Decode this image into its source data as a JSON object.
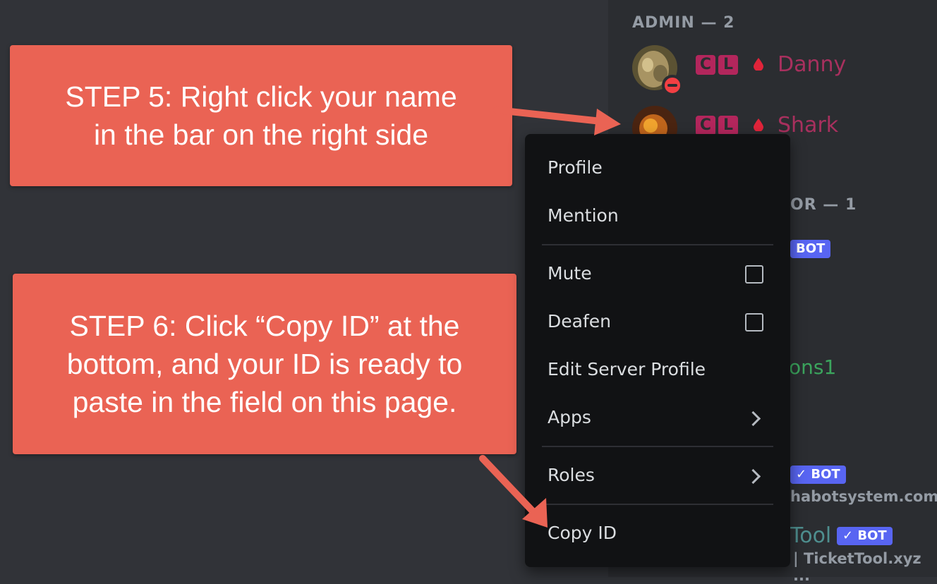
{
  "member_list": {
    "admin_header": "ADMIN — 2",
    "mod_header_partial": "OR — 1",
    "tag_c": "C",
    "tag_l": "L",
    "members": [
      {
        "name": "Danny"
      },
      {
        "name": "Shark"
      }
    ],
    "bot_badge": "BOT",
    "verified_bot_badge": "✓ BOT",
    "partial_name_green": "ons1",
    "partial_status_1": "habotsystem.com",
    "partial_name_tool": "Tool",
    "partial_status_2": "| TicketTool.xyz ..."
  },
  "callouts": {
    "step5_line1": "STEP 5: Right click your name",
    "step5_line2": "in the bar on the right side",
    "step6_line1": "STEP 6: Click “Copy ID” at the",
    "step6_line2": "bottom, and your ID is ready to",
    "step6_line3": "paste in the field on this page."
  },
  "context_menu": {
    "profile": "Profile",
    "mention": "Mention",
    "mute": "Mute",
    "deafen": "Deafen",
    "edit_server_profile": "Edit Server Profile",
    "apps": "Apps",
    "roles": "Roles",
    "copy_id": "Copy ID"
  },
  "colors": {
    "callout": "#ea6354",
    "member_name": "#a8305e",
    "bot_badge": "#5865f2",
    "menu_bg": "#111214"
  }
}
